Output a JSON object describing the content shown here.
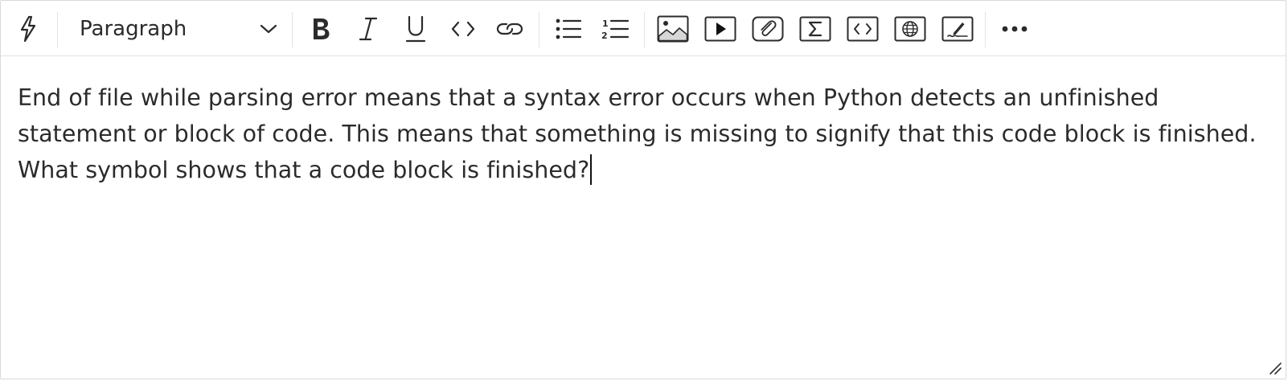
{
  "toolbar": {
    "format_select": {
      "value": "Paragraph"
    },
    "buttons": [
      {
        "name": "ai-assist-button",
        "icon": "lightning-icon"
      },
      {
        "name": "bold-button",
        "icon": "bold-icon"
      },
      {
        "name": "italic-button",
        "icon": "italic-icon"
      },
      {
        "name": "underline-button",
        "icon": "underline-icon"
      },
      {
        "name": "inline-code-button",
        "icon": "code-icon"
      },
      {
        "name": "link-button",
        "icon": "link-icon"
      },
      {
        "name": "bullet-list-button",
        "icon": "bullet-list-icon"
      },
      {
        "name": "numbered-list-button",
        "icon": "numbered-list-icon"
      },
      {
        "name": "insert-image-button",
        "icon": "image-icon"
      },
      {
        "name": "insert-video-button",
        "icon": "video-play-icon"
      },
      {
        "name": "attach-file-button",
        "icon": "paperclip-icon"
      },
      {
        "name": "insert-equation-button",
        "icon": "sigma-icon"
      },
      {
        "name": "code-block-button",
        "icon": "code-block-icon"
      },
      {
        "name": "embed-web-button",
        "icon": "globe-icon"
      },
      {
        "name": "drawing-button",
        "icon": "pen-icon"
      },
      {
        "name": "more-options-button",
        "icon": "ellipsis-icon"
      }
    ]
  },
  "editor": {
    "text": "End of file while parsing error means that a syntax error occurs when Python detects an unfinished statement or block of code. This means that something is missing to signify that this code block is finished. What symbol shows that a code block is finished?"
  }
}
